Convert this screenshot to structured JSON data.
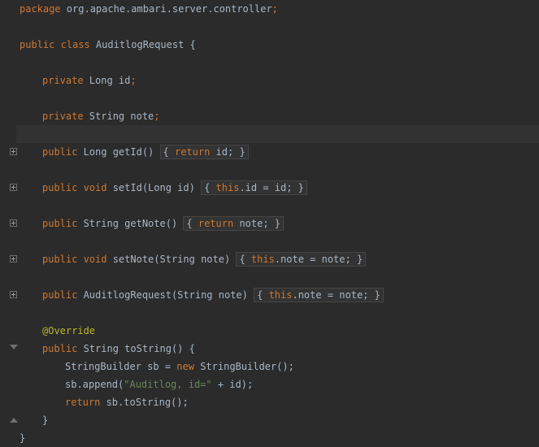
{
  "code": {
    "package_kw": "package",
    "package_name": " org.apache.ambari.server.controller",
    "package_semi": ";",
    "class_decl_kw": "public class",
    "class_name": " AuditlogRequest {",
    "field_id_kw": "private",
    "field_id_rest": " Long id",
    "field_note_kw": "private",
    "field_note_rest": " String note",
    "getId_kw": "public",
    "getId_sig": " Long getId() ",
    "getId_body_kw": "return",
    "getId_body_rest": " id; }",
    "setId_kw": "public void",
    "setId_sig": " setId(Long id) ",
    "setId_this": "this",
    "setId_rest": ".id = id; }",
    "getNote_kw": "public",
    "getNote_sig": " String getNote() ",
    "getNote_body_kw": "return",
    "getNote_body_rest": " note; }",
    "setNote_kw": "public void",
    "setNote_sig": " setNote(String note) ",
    "setNote_this": "this",
    "setNote_rest": ".note = note; }",
    "ctor_kw": "public",
    "ctor_sig": " AuditlogRequest(String note) ",
    "ctor_this": "this",
    "ctor_rest": ".note = note; }",
    "override": "@Override",
    "toString_kw": "public",
    "toString_sig": " String toString() {",
    "sb_decl_a": "StringBuilder sb = ",
    "sb_new": "new",
    "sb_decl_b": " StringBuilder();",
    "append_a": "sb.append(",
    "append_str": "\"Auditlog, id=\"",
    "append_b": " + id);",
    "return_kw": "return",
    "return_rest": " sb.toString();",
    "close_method": "}",
    "close_class": "}"
  },
  "colors": {
    "background": "#2b2b2b",
    "keyword": "#cc7832",
    "string": "#6a8759",
    "annotation": "#bbb529",
    "text": "#a9b7c6"
  }
}
